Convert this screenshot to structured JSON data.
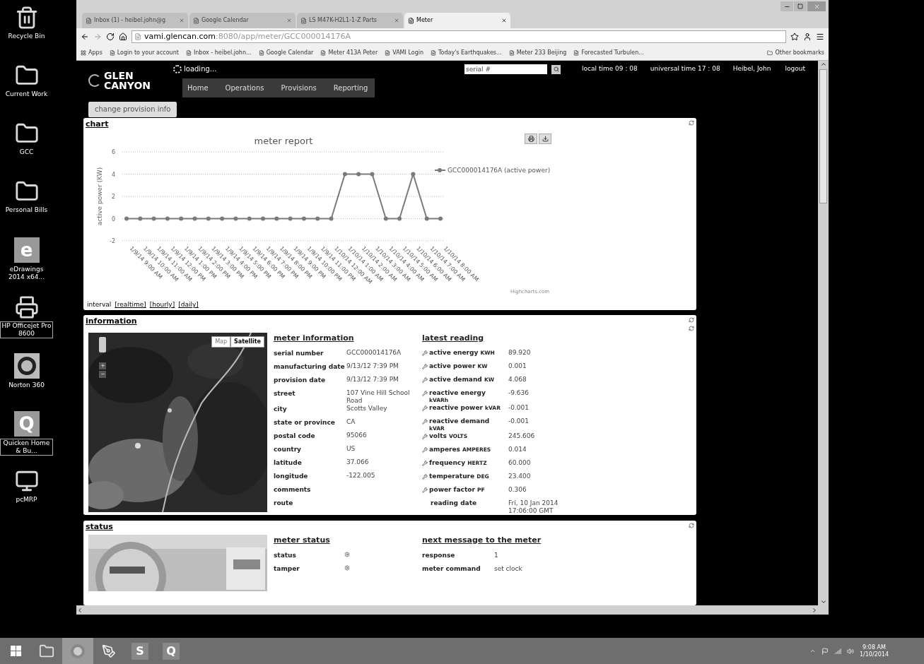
{
  "desktop_icons": [
    {
      "label": "Recycle Bin",
      "kind": "trash",
      "selected": false
    },
    {
      "label": "Current Work",
      "kind": "folder",
      "selected": false
    },
    {
      "label": "GCC",
      "kind": "folder",
      "selected": false
    },
    {
      "label": "Personal Bills",
      "kind": "folder",
      "selected": false
    },
    {
      "label": "eDrawings 2014 x64...",
      "kind": "letter",
      "glyph": "e",
      "selected": false
    },
    {
      "label": "HP Officejet Pro 8600",
      "kind": "printer",
      "selected": true
    },
    {
      "label": "Norton 360",
      "kind": "ring",
      "selected": false
    },
    {
      "label": "Quicken Home & Bu...",
      "kind": "letter",
      "glyph": "Q",
      "selected": true
    },
    {
      "label": "pcMRP",
      "kind": "monitor",
      "selected": false
    }
  ],
  "browser": {
    "tabs": [
      {
        "title": "Inbox (1) - heibel.john@g",
        "selected": false
      },
      {
        "title": "Google Calendar",
        "selected": false
      },
      {
        "title": "LS M47K-H2L1-1-Z Parts",
        "selected": false
      },
      {
        "title": "Meter",
        "selected": true
      }
    ],
    "address": {
      "host": "vami.glencan.com",
      "path": ":8080/app/meter/GCC000014176A"
    },
    "apps": "Apps",
    "bookmarks": [
      "Login to your account",
      "Inbox - heibel.john...",
      "Google Calendar",
      "Meter 413A Peter",
      "VAMI Login",
      "Today's Earthquakes...",
      "Meter 233 Beijing",
      "Forecasted Turbulen..."
    ],
    "other_bookmarks": "Other bookmarks"
  },
  "header": {
    "logo": [
      "GLEN",
      "CANYON"
    ],
    "loading": "loading...",
    "nav": [
      "Home",
      "Operations",
      "Provisions",
      "Reporting"
    ],
    "search_placeholder": "serial #",
    "local_time": "local time 09 : 08",
    "universal_time": "universal time 17 : 08",
    "user": "Heibel, John",
    "logout": "logout",
    "change_button": "change provision info"
  },
  "chart_panel": {
    "title": "chart",
    "chart_data": {
      "type": "line",
      "title": "meter report",
      "ylabel": "active power (KW)",
      "categories": [
        "1/9/14 9:00 AM",
        "1/9/14 10:00 AM",
        "1/9/14 11:00 AM",
        "1/9/14 12:00 PM",
        "1/9/14 1:00 PM",
        "1/9/14 2:00 PM",
        "1/9/14 3:00 PM",
        "1/9/14 4:00 PM",
        "1/9/14 5:00 PM",
        "1/9/14 6:00 PM",
        "1/9/14 7:00 PM",
        "1/9/14 8:00 PM",
        "1/9/14 9:00 PM",
        "1/9/14 10:00 PM",
        "1/9/14 11:00 PM",
        "1/10/14 12:00 AM",
        "1/10/14 1:00 AM",
        "1/10/14 2:00 AM",
        "1/10/14 3:00 AM",
        "1/10/14 4:00 AM",
        "1/10/14 5:00 AM",
        "1/10/14 6:00 AM",
        "1/10/14 7:00 AM",
        "1/10/14 8:00 AM"
      ],
      "series": [
        {
          "name": "GCC000014176A (active power)",
          "color": "#7a7a7a",
          "values": [
            0,
            0,
            0,
            0,
            0,
            0,
            0,
            0,
            0,
            0,
            0,
            0,
            0,
            0,
            0,
            0,
            4,
            4,
            4,
            0,
            0,
            4,
            0,
            0
          ]
        }
      ],
      "ylim": [
        -2,
        6
      ],
      "yticks": [
        -2,
        0,
        2,
        4,
        6
      ],
      "grid": true,
      "marker": true
    },
    "credit": "Highcharts.com",
    "interval_label": "interval",
    "interval_links": [
      "[realtime]",
      "[hourly]",
      "[daily]"
    ]
  },
  "information": {
    "title": "information",
    "map": {
      "types": [
        {
          "label": "Map",
          "selected": false
        },
        {
          "label": "Satellite",
          "selected": true
        }
      ]
    },
    "meter_information": {
      "title": "meter information",
      "fields": [
        {
          "label": "serial number",
          "value": "GCC000014176A"
        },
        {
          "label": "manufacturing date",
          "value": "9/13/12 7:39 PM"
        },
        {
          "label": "provision date",
          "value": "9/13/12 7:39 PM"
        },
        {
          "label": "street",
          "value": "107 Vine Hill School Road"
        },
        {
          "label": "city",
          "value": "Scotts Valley"
        },
        {
          "label": "state or province",
          "value": "CA"
        },
        {
          "label": "postal code",
          "value": "95066"
        },
        {
          "label": "country",
          "value": "US"
        },
        {
          "label": "latitude",
          "value": "37.066"
        },
        {
          "label": "longitude",
          "value": "-122.005"
        },
        {
          "label": "comments"
        },
        {
          "label": "route"
        }
      ]
    },
    "latest_reading": {
      "title": "latest reading",
      "rows": [
        {
          "kind": "reading",
          "label": "active energy",
          "unit": "KWH",
          "value": "89.920"
        },
        {
          "kind": "reading",
          "label": "active power",
          "unit": "KW",
          "value": "0.001"
        },
        {
          "kind": "reading",
          "label": "active demand",
          "unit": "KW",
          "value": "4.068"
        },
        {
          "kind": "reading",
          "label": "reactive energy",
          "unit": "kVARh",
          "value": "-9.636"
        },
        {
          "kind": "reading",
          "label": "reactive power",
          "unit": "kVAR",
          "value": "-0.001"
        },
        {
          "kind": "reading",
          "label": "reactive demand",
          "unit": "kVAR",
          "value": "-0.001"
        },
        {
          "kind": "reading",
          "label": "volts",
          "unit": "VOLTS",
          "value": "245.606"
        },
        {
          "kind": "reading",
          "label": "amperes",
          "unit": "AMPERES",
          "value": "0.014"
        },
        {
          "kind": "reading",
          "label": "frequency",
          "unit": "HERTZ",
          "value": "60.000"
        },
        {
          "kind": "reading",
          "label": "temperature",
          "unit": "DEG",
          "value": "23.400"
        },
        {
          "kind": "reading",
          "label": "power factor",
          "unit": "PF",
          "value": "0.306"
        },
        {
          "kind": "date",
          "label": "reading date",
          "value": "Fri, 10 Jan 2014 17:06:00 GMT"
        }
      ]
    }
  },
  "status": {
    "title": "status",
    "meter_status": {
      "title": "meter status",
      "rows": [
        "status",
        "tamper"
      ]
    },
    "next_message": {
      "title": "next message to the meter",
      "rows": [
        {
          "label": "response",
          "value": "1"
        },
        {
          "label": "meter command",
          "value": "set clock"
        }
      ]
    }
  },
  "taskbar": {
    "apps": [
      {
        "kind": "folder",
        "active": false
      },
      {
        "kind": "browser",
        "active": true
      },
      {
        "kind": "pen",
        "active": false
      },
      {
        "kind": "letter",
        "glyph": "S",
        "active": false
      },
      {
        "kind": "letter",
        "glyph": "Q",
        "active": false
      }
    ],
    "time": "9:08 AM",
    "date": "1/10/2014"
  }
}
